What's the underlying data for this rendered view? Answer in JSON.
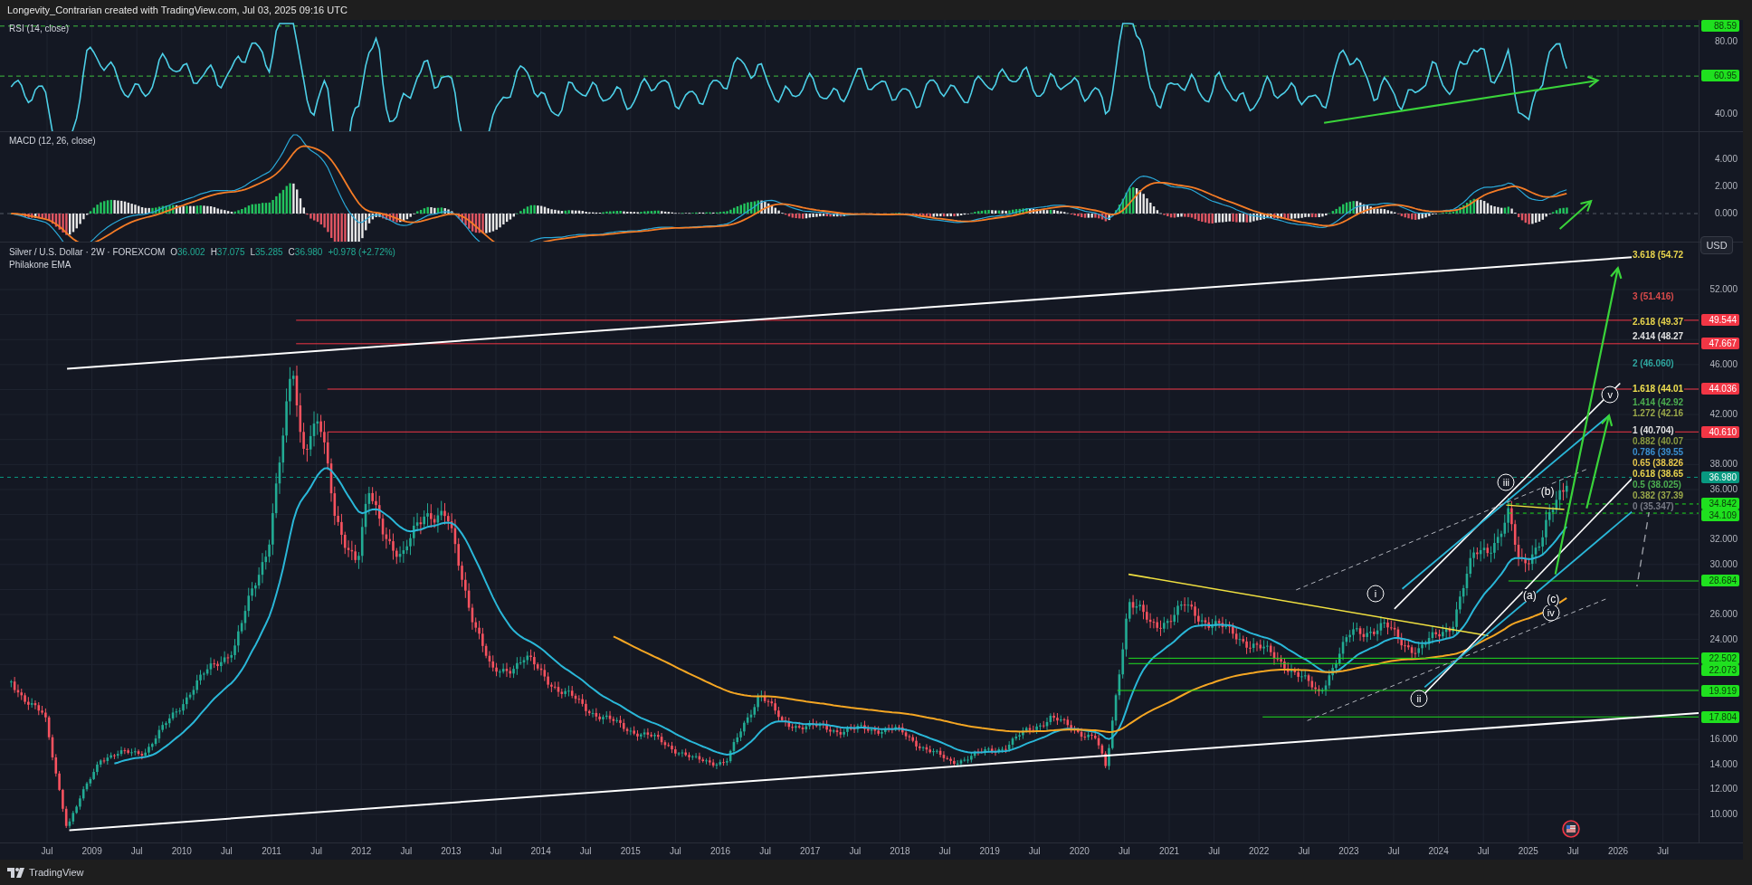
{
  "header": {
    "text": "Longevity_Contrarian created with TradingView.com, Jul 03, 2025 09:16 UTC"
  },
  "rsi": {
    "title": "RSI (14, close)",
    "ticks": [
      "80.00",
      "40.00"
    ],
    "tags": [
      "88.59",
      "60.95"
    ]
  },
  "macd": {
    "title": "MACD (12, 26, close)",
    "ticks": [
      "4.000",
      "2.000",
      "0.000"
    ]
  },
  "price": {
    "symbol": "Silver / U.S. Dollar · 2W · FOREXCOM",
    "ohlc": [
      {
        "key": "O",
        "value": "36.002"
      },
      {
        "key": "H",
        "value": "37.075"
      },
      {
        "key": "L",
        "value": "35.285"
      },
      {
        "key": "C",
        "value": "36.980"
      }
    ],
    "change": "+0.978 (+2.72%)",
    "indicator": "Philakone EMA",
    "currency": "USD",
    "ticks": [
      "52.000",
      "46.000",
      "42.000",
      "38.000",
      "36.000",
      "32.000",
      "30.000",
      "26.000",
      "24.000",
      "16.000",
      "14.000",
      "12.000",
      "10.000"
    ],
    "tags": [
      {
        "text": "49.544",
        "color": "#f23645"
      },
      {
        "text": "47.667",
        "color": "#f23645"
      },
      {
        "text": "44.036",
        "color": "#f23645"
      },
      {
        "text": "40.610",
        "color": "#f23645"
      },
      {
        "text": "36.980",
        "color": "#089981"
      },
      {
        "text": "34.842",
        "color": "#1fe01f"
      },
      {
        "text": "34.109",
        "color": "#1fe01f"
      },
      {
        "text": "28.684",
        "color": "#1fe01f"
      },
      {
        "text": "22.502",
        "color": "#1fe01f"
      },
      {
        "text": "22.073",
        "color": "#1fe01f"
      },
      {
        "text": "19.919",
        "color": "#1fe01f"
      },
      {
        "text": "17.804",
        "color": "#1fe01f"
      }
    ],
    "fib_levels": [
      {
        "text": "3.618 (54.72",
        "color": "#e8d44d"
      },
      {
        "text": "3 (51.416)",
        "color": "#d84a4a"
      },
      {
        "text": "2.618 (49.37",
        "color": "#e8d44d"
      },
      {
        "text": "2.414 (48.27",
        "color": "#e0e0e0"
      },
      {
        "text": "2 (46.060)",
        "color": "#2fa7a0"
      },
      {
        "text": "1.618 (44.01",
        "color": "#f0e050"
      },
      {
        "text": "1.414 (42.92",
        "color": "#4caf50"
      },
      {
        "text": "1.272 (42.16",
        "color": "#9aa84a"
      },
      {
        "text": "1 (40.704)",
        "color": "#e0e0e0"
      },
      {
        "text": "0.882 (40.07",
        "color": "#8a9a40"
      },
      {
        "text": "0.786 (39.55",
        "color": "#3a8fd0"
      },
      {
        "text": "0.65 (38.826",
        "color": "#e8c84d"
      },
      {
        "text": "0.618 (38.65",
        "color": "#e8d44d"
      },
      {
        "text": "0.5 (38.025)",
        "color": "#4caf50"
      },
      {
        "text": "0.382 (37.39",
        "color": "#9aa84a"
      },
      {
        "text": "0 (35.347)",
        "color": "#787b86"
      }
    ],
    "wave_labels": [
      {
        "text": "i",
        "kind": "circled"
      },
      {
        "text": "ii",
        "kind": "circled"
      },
      {
        "text": "iii",
        "kind": "circled"
      },
      {
        "text": "iv",
        "kind": "circled"
      },
      {
        "text": "v",
        "kind": "circled"
      },
      {
        "text": "(a)",
        "kind": "plain"
      },
      {
        "text": "(b)",
        "kind": "plain"
      },
      {
        "text": "(c)",
        "kind": "plain"
      }
    ]
  },
  "time_axis": [
    "Jul",
    "2009",
    "Jul",
    "2010",
    "Jul",
    "2011",
    "Jul",
    "2012",
    "Jul",
    "2013",
    "Jul",
    "2014",
    "Jul",
    "2015",
    "Jul",
    "2016",
    "Jul",
    "2017",
    "Jul",
    "2018",
    "Jul",
    "2019",
    "Jul",
    "2020",
    "Jul",
    "2021",
    "Jul",
    "2022",
    "Jul",
    "2023",
    "Jul",
    "2024",
    "Jul",
    "2025",
    "Jul",
    "2026",
    "Jul"
  ],
  "footer": {
    "brand": "TradingView"
  }
}
